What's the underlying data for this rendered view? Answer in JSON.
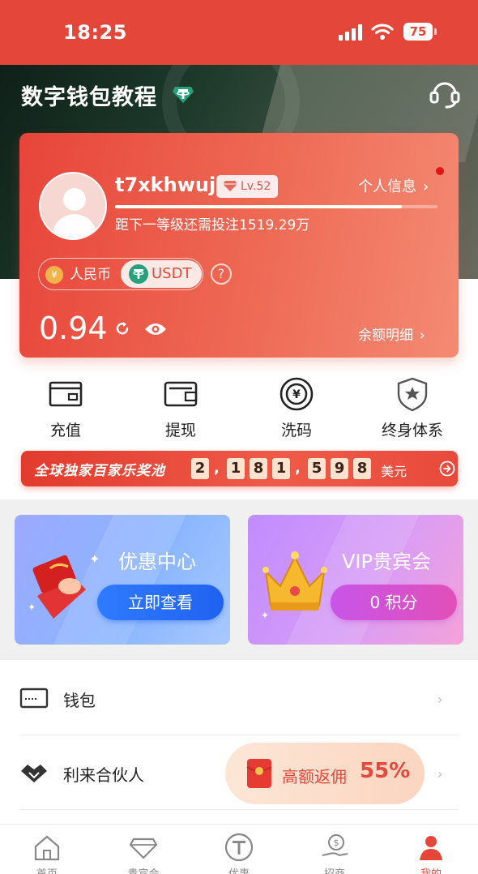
{
  "status_bar": {
    "time": "18:25",
    "battery": "75"
  },
  "header": {
    "title": "数字钱包教程"
  },
  "profile": {
    "username": "t7xkhwuja",
    "level": "Lv.52",
    "info_link": "个人信息",
    "level_progress": 0.89,
    "next_level_text": "距下一等级还需投注1519.29万"
  },
  "currency": {
    "rmb": "人民币",
    "rmb_symbol": "¥",
    "usdt": "USDT",
    "help": "?"
  },
  "wallet": {
    "balance": "0.94",
    "detail_link": "余额明细"
  },
  "actions": [
    {
      "label": "充值",
      "icon": "wallet-card-icon"
    },
    {
      "label": "提现",
      "icon": "wallet-icon"
    },
    {
      "label": "洗码",
      "icon": "yuan-coin-icon"
    },
    {
      "label": "终身体系",
      "icon": "shield-star-icon"
    }
  ],
  "jackpot": {
    "title": "全球独家百家乐奖池",
    "digits": [
      "2",
      ",",
      "1",
      "8",
      "1",
      ",",
      "5",
      "9",
      "8"
    ],
    "amount": 2181598,
    "unit": "美元"
  },
  "promos": {
    "offers": {
      "title": "优惠中心",
      "button": "立即查看"
    },
    "vip": {
      "title": "VIP贵宾会",
      "button": "0 积分"
    }
  },
  "menu": {
    "wallet": {
      "label": "钱包"
    },
    "partner": {
      "label": "利来合伙人",
      "rebate_label": "高额返佣",
      "rebate_value": "55%"
    }
  },
  "tabs": [
    "首页",
    "贵宾会",
    "优惠",
    "招商",
    "我的"
  ],
  "colors": {
    "brand_red": "#e5463a",
    "offers_blue": "#2062f0",
    "vip_pink": "#e24fb8"
  }
}
